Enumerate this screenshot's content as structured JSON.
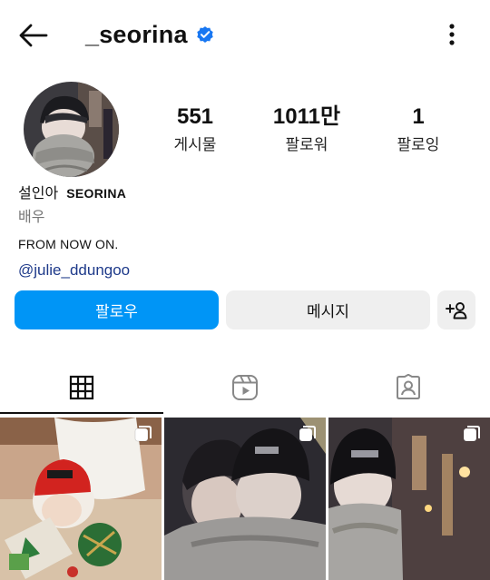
{
  "header": {
    "username": "_seorina",
    "verified": true,
    "back_icon": "arrow-left-icon",
    "more_icon": "more-vertical-icon"
  },
  "stats": [
    {
      "value": "551",
      "label": "게시물"
    },
    {
      "value": "1011만",
      "label": "팔로워"
    },
    {
      "value": "1",
      "label": "팔로잉"
    }
  ],
  "bio": {
    "name": "설인아",
    "name_en": "SEORINA",
    "category": "배우",
    "text": "FROM NOW ON.",
    "link": "@julie_ddungoo"
  },
  "actions": {
    "follow_label": "팔로우",
    "message_label": "메시지",
    "add_person_icon": "add-person-icon"
  },
  "tabs": [
    {
      "icon": "grid-icon",
      "active": true
    },
    {
      "icon": "reels-icon",
      "active": false
    },
    {
      "icon": "tagged-icon",
      "active": false
    }
  ],
  "colors": {
    "accent": "#0095f6",
    "verified": "#1877f2",
    "secondary_button": "#efefef",
    "link": "#1e3a8a"
  },
  "posts": [
    {
      "multi": true
    },
    {
      "multi": true
    },
    {
      "multi": true
    }
  ]
}
